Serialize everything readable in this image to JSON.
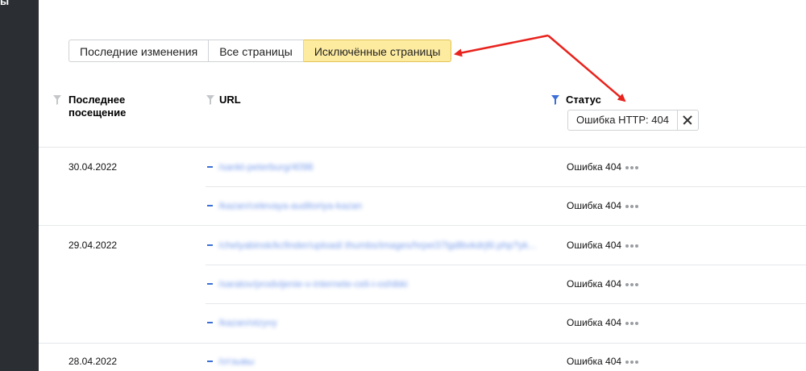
{
  "sidebar": {
    "label": "ы"
  },
  "tabs": [
    {
      "label": "Последние изменения",
      "active": false
    },
    {
      "label": "Все страницы",
      "active": false
    },
    {
      "label": "Исключённые страницы",
      "active": true
    }
  ],
  "columns": {
    "last_visit": "Последнее посещение",
    "url": "URL",
    "status": "Статус"
  },
  "filter_chip": {
    "text": "Ошибка HTTP: 404"
  },
  "rows": [
    {
      "date": "30.04.2022",
      "url": "/sankt-peterburg/4098",
      "status": "Ошибка 404"
    },
    {
      "date": "",
      "url": "/kazan/celevaya-auditoriya-kazan",
      "status": "Ошибка 404"
    },
    {
      "date": "29.04.2022",
      "url": "/chelyabinsk/kcfinder/upload/.thumbs/images/hrpei37lgdlbvkdrj6l.php?yk...",
      "status": "Ошибка 404"
    },
    {
      "date": "",
      "url": "/saratov/prodvijenie-v-internete-celi-i-oshibki",
      "status": "Ошибка 404"
    },
    {
      "date": "",
      "url": "/kazan/otzyvy",
      "status": "Ошибка 404"
    },
    {
      "date": "28.04.2022",
      "url": "/отзывы",
      "status": "Ошибка 404"
    }
  ],
  "colors": {
    "accent_tab": "#fdeba0",
    "filter_active": "#3b6fd8",
    "arrow": "#e8231d"
  }
}
